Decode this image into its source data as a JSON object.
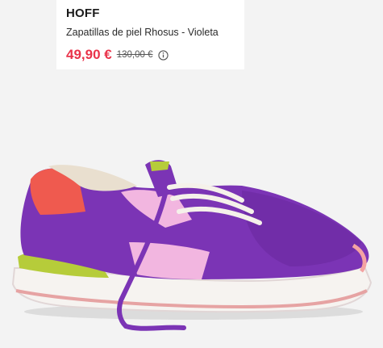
{
  "product_card": {
    "brand": "HOFF",
    "name": "Zapatillas de piel Rhosus - Violeta",
    "price_current": "49,90 €",
    "price_old": "130,00 €",
    "info_icon": "info-circle-icon"
  },
  "colors": {
    "price_accent": "#e9334a",
    "shoe_purple": "#7b34b5",
    "shoe_pink": "#f2b6e0",
    "heel_coral": "#ef5a4f",
    "sole_green": "#b6cc3a"
  }
}
